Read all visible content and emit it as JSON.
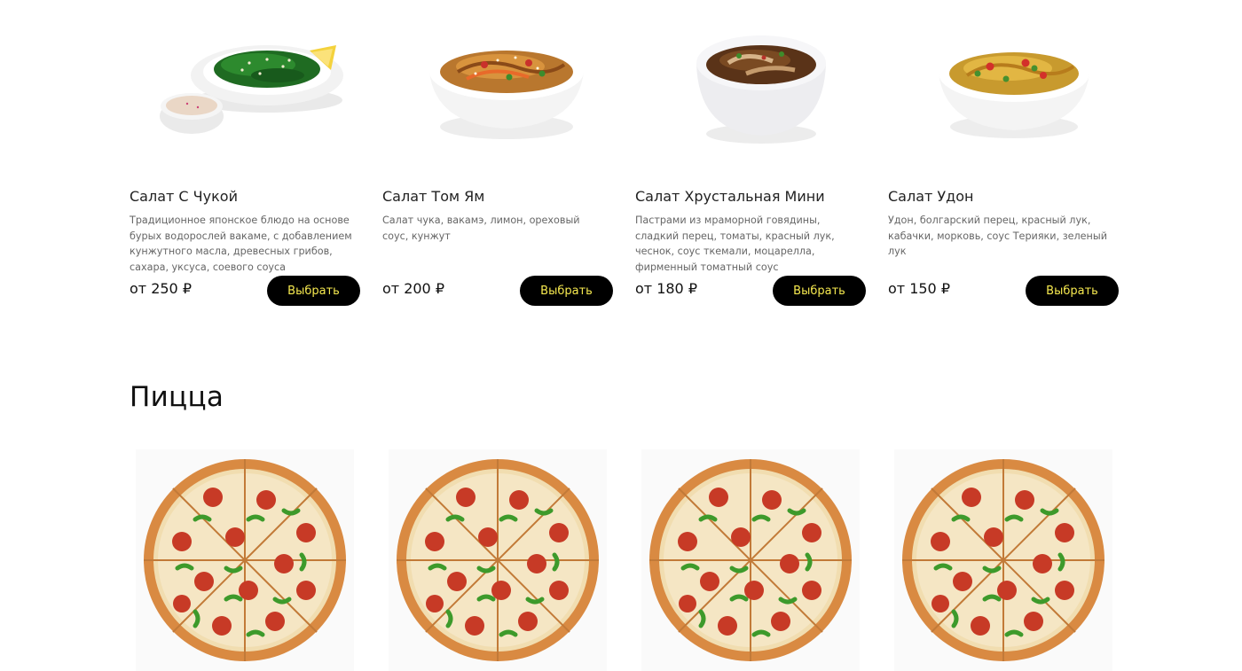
{
  "salads": [
    {
      "title": "Салат С Чукой",
      "description": "Традиционное японское блюдо на основе бурых водорослей вакаме, с добавлением кунжутного масла, древесных грибов, сахара, уксуса, соевого соуса",
      "price": "от 250 ₽",
      "button": "Выбрать",
      "image_icon": "seaweed-salad-icon"
    },
    {
      "title": "Салат Том Ям",
      "description": "Салат чука, вакамэ, лимон, ореховый соус, кунжут",
      "price": "от 200 ₽",
      "button": "Выбрать",
      "image_icon": "noodle-bowl-icon"
    },
    {
      "title": "Салат Хрустальная Мини",
      "description": "Пастрами из мраморной говядины, сладкий перец, томаты, красный лук, чеснок, соус ткемали, моцарелла, фирменный томатный соус",
      "price": "от 180 ₽",
      "button": "Выбрать",
      "image_icon": "meat-salad-bowl-icon"
    },
    {
      "title": "Салат Удон",
      "description": " Удон, болгарский перец, красный лук, кабачки, морковь, соус Терияки, зеленый лук",
      "price": "от 150 ₽",
      "button": "Выбрать",
      "image_icon": "udon-bowl-icon"
    }
  ],
  "pizza_section": {
    "title": "Пицца",
    "items": [
      {
        "image_icon": "pepperoni-pizza-icon"
      },
      {
        "image_icon": "pepperoni-pizza-icon"
      },
      {
        "image_icon": "pepperoni-pizza-icon"
      },
      {
        "image_icon": "pepperoni-pizza-icon"
      }
    ]
  },
  "colors": {
    "button_bg": "#000000",
    "button_text": "#f6e94f",
    "text": "#222222",
    "muted_text": "#666666",
    "page_bg": "#ffffff"
  }
}
